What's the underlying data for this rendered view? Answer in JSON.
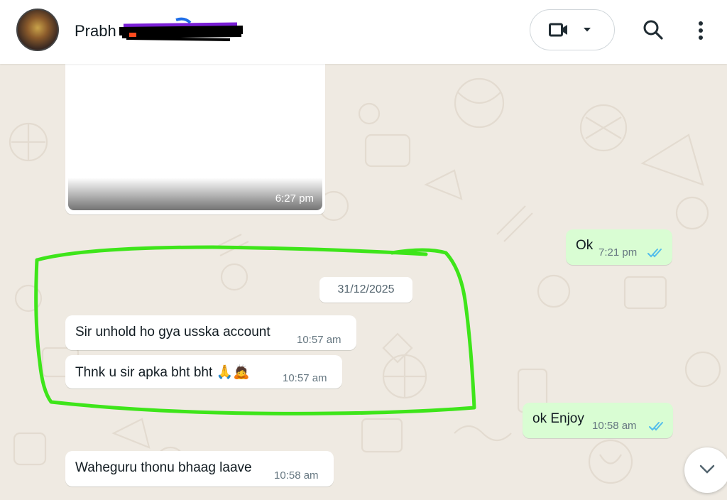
{
  "header": {
    "contact_name": "Prabh",
    "icons": [
      "avatar",
      "video-call-icon",
      "chevron-down-icon",
      "search-icon",
      "more-vertical-icon"
    ]
  },
  "messages": {
    "image_time": "6:27 pm",
    "ok": {
      "text": "Ok",
      "time": "7:21 pm"
    },
    "date_separator": "31/12/2025",
    "unhold": {
      "text": "Sir unhold ho gya usska account",
      "time": "10:57 am"
    },
    "thanks": {
      "text": "Thnk u sir apka bht bht 🙏🙇",
      "time": "10:57 am"
    },
    "enjoy": {
      "text": "ok Enjoy",
      "time": "10:58 am"
    },
    "waheguru": {
      "text": "Waheguru thonu bhaag laave",
      "time": "10:58 am"
    }
  },
  "colors": {
    "chat_bg": "#efeae2",
    "outgoing_bubble": "#d9fdd3",
    "incoming_bubble": "#ffffff",
    "read_ticks": "#53bdeb",
    "annotation_stroke": "#3ee51a",
    "redaction": "#000000"
  }
}
